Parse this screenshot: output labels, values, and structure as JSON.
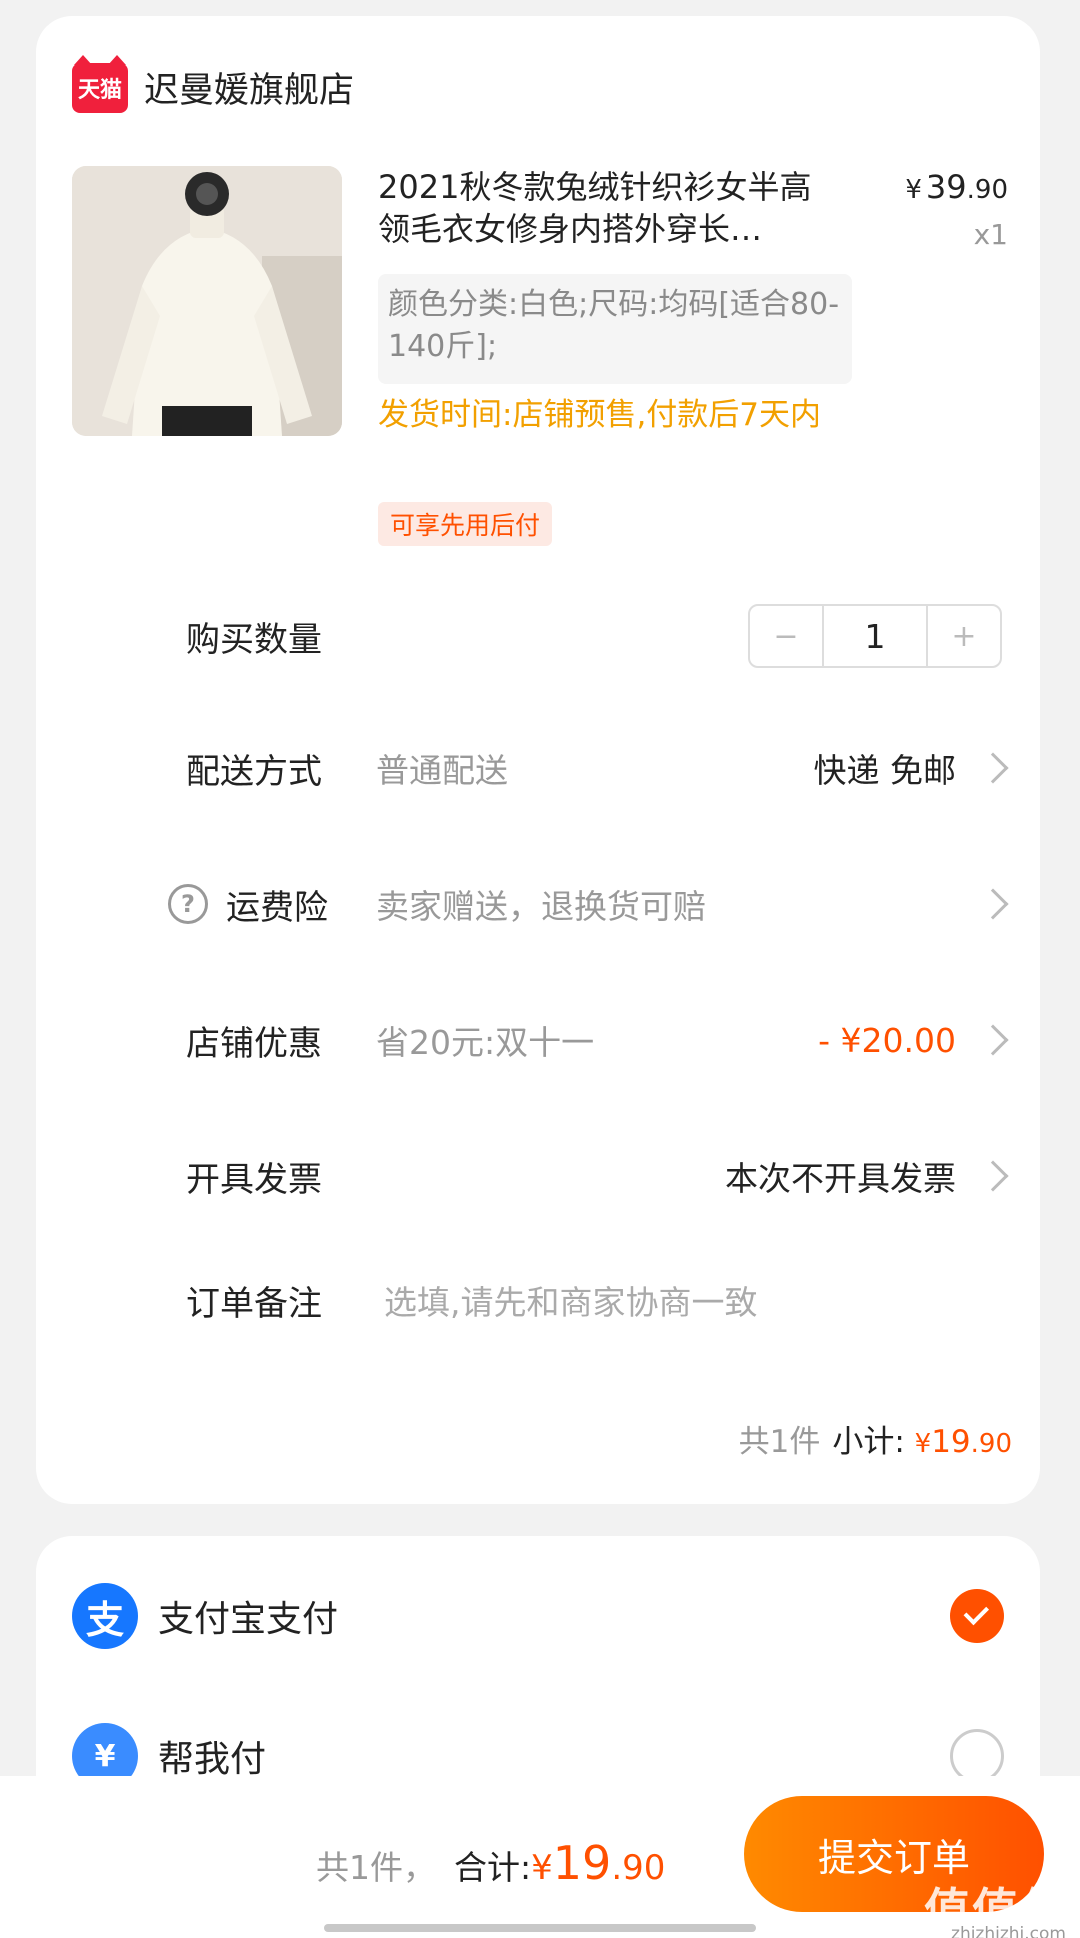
{
  "shop": {
    "badge": "天猫",
    "name": "迟曼媛旗舰店"
  },
  "product": {
    "image_alt": "white knit sweater photo",
    "title": "2021秋冬款兔绒针织衫女半高领毛衣女修身内搭外穿长…",
    "price_symbol": "¥",
    "price_int": "39",
    "price_dec": ".90",
    "quantity_label": "x1",
    "sku": "颜色分类:白色;尺码:均码[适合80-140斤];",
    "ship_time": "发货时间:店铺预售,付款后7天内",
    "tag": "可享先用后付"
  },
  "quantity": {
    "label": "购买数量",
    "minus": "−",
    "value": "1",
    "plus": "+"
  },
  "delivery": {
    "label": "配送方式",
    "sub": "普通配送",
    "value": "快递 免邮"
  },
  "insurance": {
    "icon": "?",
    "label": "运费险",
    "sub": "卖家赠送，退换货可赔"
  },
  "discount": {
    "label": "店铺优惠",
    "sub": "省20元:双十一",
    "value": "- ¥20.00"
  },
  "invoice": {
    "label": "开具发票",
    "value": "本次不开具发票"
  },
  "note": {
    "label": "订单备注",
    "placeholder": "选填,请先和商家协商一致"
  },
  "subtotal": {
    "count": "共1件",
    "label": "小计:",
    "symbol": "¥",
    "int": "19",
    "dec": ".90"
  },
  "payment": {
    "alipay_icon": "支",
    "alipay_label": "支付宝支付",
    "helper_icon": "¥",
    "helper_label": "帮我付"
  },
  "footer": {
    "count": "共1件，",
    "label": "合计:",
    "symbol": "¥",
    "int": "19",
    "dec": ".90",
    "submit": "提交订单",
    "watermark": "值值值",
    "watermark_site": "zhizhizhi.com"
  },
  "colors": {
    "accent": "#ff5000",
    "ship_time": "#f2a000",
    "alipay": "#1677ff"
  }
}
